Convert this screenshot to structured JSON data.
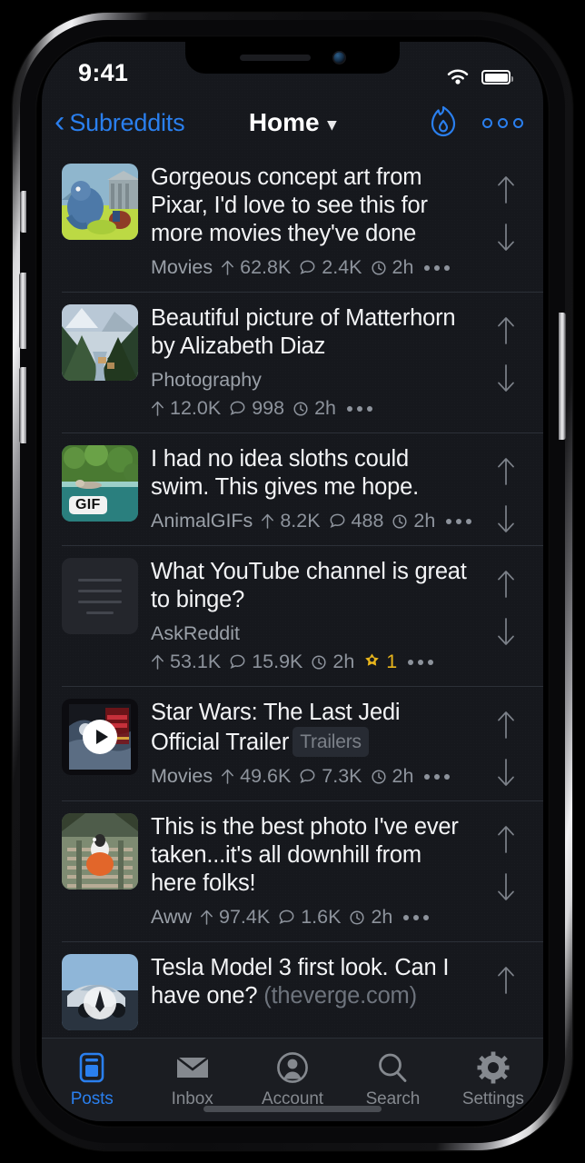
{
  "status_bar": {
    "time": "9:41",
    "wifi_icon": "wifi-icon",
    "battery_icon": "battery-full-icon"
  },
  "nav": {
    "back_label": "Subreddits",
    "back_icon": "chevron-left-icon",
    "title": "Home",
    "title_caret_icon": "chevron-down-icon",
    "hot_icon": "flame-icon",
    "more_icon": "more-circles-icon",
    "accent_color": "#2a7fee"
  },
  "feed": {
    "upvote_icon": "arrow-up-icon",
    "downvote_icon": "arrow-down-icon",
    "comment_icon": "comment-bubble-icon",
    "time_icon": "clock-icon",
    "score_icon": "arrow-up-icon",
    "overflow_icon": "ellipsis-icon",
    "award_icon": "gold-star-award-icon",
    "posts": [
      {
        "title": "Gorgeous concept art from Pixar, I'd love to see this for more movies they've done",
        "subreddit": "Movies",
        "score": "62.8K",
        "comments": "2.4K",
        "age": "2h",
        "thumb": "pixar-concept-art",
        "meta_layout": "one-line"
      },
      {
        "title": "Beautiful picture of Matterhorn by Alizabeth Diaz",
        "subreddit": "Photography",
        "score": "12.0K",
        "comments": "998",
        "age": "2h",
        "thumb": "matterhorn-valley",
        "meta_layout": "two-line"
      },
      {
        "title": "I had no idea sloths could swim. This gives me hope.",
        "subreddit": "AnimalGIFs",
        "score": "8.2K",
        "comments": "488",
        "age": "2h",
        "thumb": "sloth-swimming",
        "badge": "GIF",
        "meta_layout": "one-line"
      },
      {
        "title": "What YouTube channel is great to binge?",
        "subreddit": "AskReddit",
        "score": "53.1K",
        "comments": "15.9K",
        "age": "2h",
        "award_count": "1",
        "thumb": "text-post",
        "meta_layout": "two-line"
      },
      {
        "title": "Star Wars: The Last Jedi Official Trailer",
        "flair": "Trailers",
        "subreddit": "Movies",
        "score": "49.6K",
        "comments": "7.3K",
        "age": "2h",
        "thumb": "star-wars-trailer",
        "is_video": true,
        "meta_layout": "one-line"
      },
      {
        "title": "This is the best photo I've ever taken...it's all downhill from here folks!",
        "subreddit": "Aww",
        "score": "97.4K",
        "comments": "1.6K",
        "age": "2h",
        "thumb": "dog-backpack-trestle",
        "meta_layout": "one-line"
      },
      {
        "title": "Tesla Model 3 first look. Can I have one?",
        "domain": "(theverge.com)",
        "thumb": "tesla-model-3",
        "meta_layout": "clipped"
      }
    ]
  },
  "tabbar": {
    "items": [
      {
        "label": "Posts",
        "icon": "posts-icon",
        "active": true
      },
      {
        "label": "Inbox",
        "icon": "envelope-icon",
        "active": false
      },
      {
        "label": "Account",
        "icon": "person-circle-icon",
        "active": false
      },
      {
        "label": "Search",
        "icon": "magnifier-icon",
        "active": false
      },
      {
        "label": "Settings",
        "icon": "gear-icon",
        "active": false
      }
    ]
  }
}
